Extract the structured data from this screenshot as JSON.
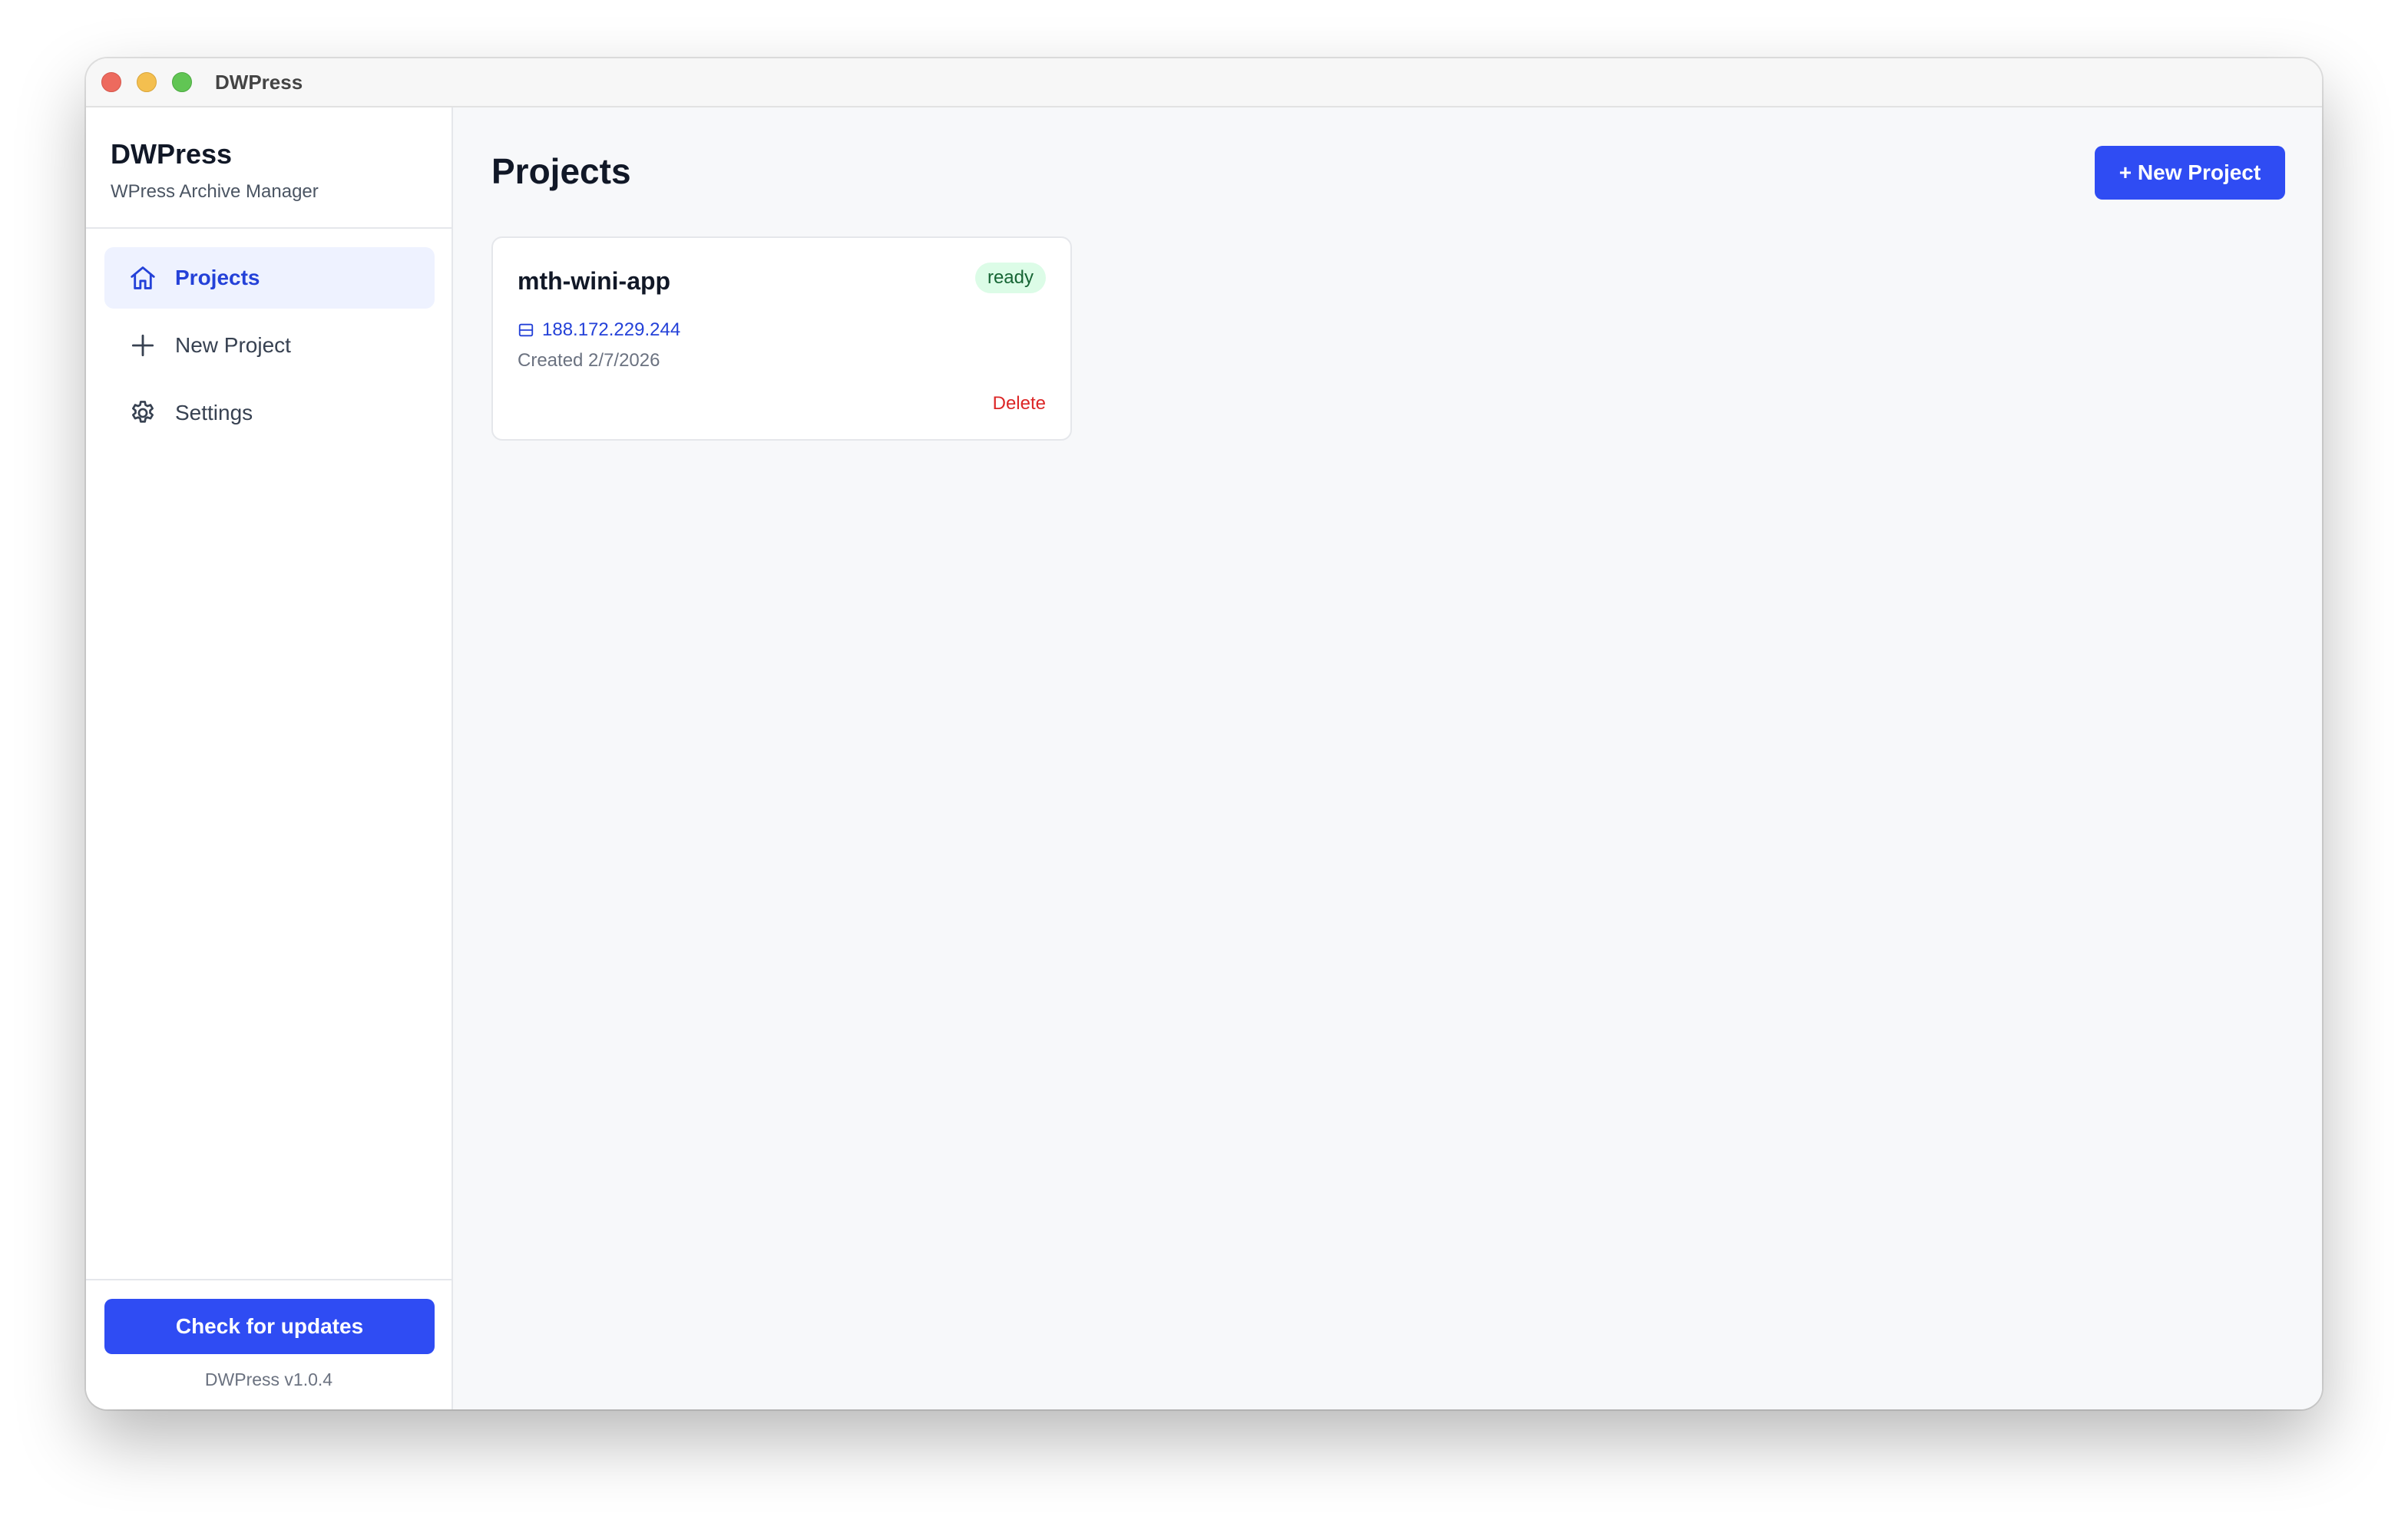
{
  "window": {
    "title": "DWPress"
  },
  "sidebar": {
    "brand_name": "DWPress",
    "brand_subtitle": "WPress Archive Manager",
    "items": [
      {
        "label": "Projects",
        "icon": "home-icon",
        "active": true
      },
      {
        "label": "New Project",
        "icon": "plus-icon",
        "active": false
      },
      {
        "label": "Settings",
        "icon": "gear-icon",
        "active": false
      }
    ],
    "update_button_label": "Check for updates",
    "version": "DWPress v1.0.4"
  },
  "main": {
    "title": "Projects",
    "new_project_label": "+ New Project",
    "projects": [
      {
        "name": "mth-wini-app",
        "status": "ready",
        "ip": "188.172.229.244",
        "created": "Created 2/7/2026",
        "delete_label": "Delete"
      }
    ]
  },
  "colors": {
    "accent": "#2f4cf3",
    "active_nav_bg": "#eef2ff",
    "status_ready_bg": "#dcfce7",
    "status_ready_text": "#166534",
    "danger": "#dc2626"
  }
}
